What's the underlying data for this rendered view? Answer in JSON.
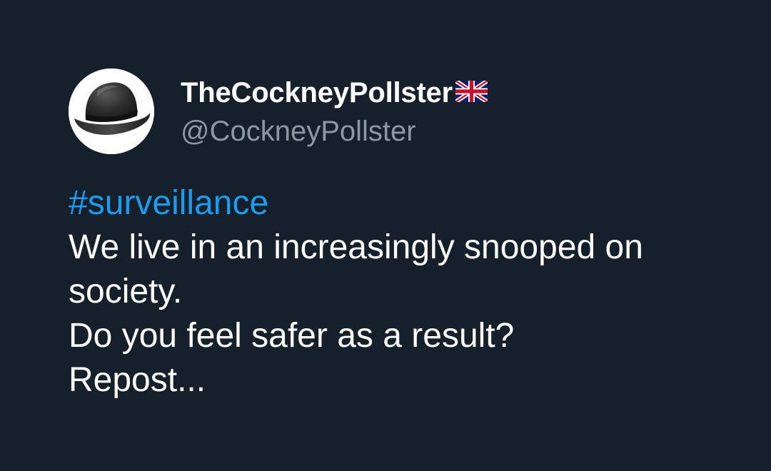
{
  "tweet": {
    "author": {
      "display_name": "TheCockneyPollster",
      "handle": "@CockneyPollster",
      "avatar_icon": "bowler-hat-icon",
      "flag_icon": "uk-flag-icon"
    },
    "body": {
      "hashtag": "#surveillance",
      "lines": [
        "We live in an increasingly snooped on",
        "society.",
        "Do you feel safer as a result?",
        "Repost..."
      ]
    }
  },
  "colors": {
    "background": "#16202a",
    "text": "#ffffff",
    "secondary_text": "#8b98a5",
    "link": "#1d9bf0"
  }
}
